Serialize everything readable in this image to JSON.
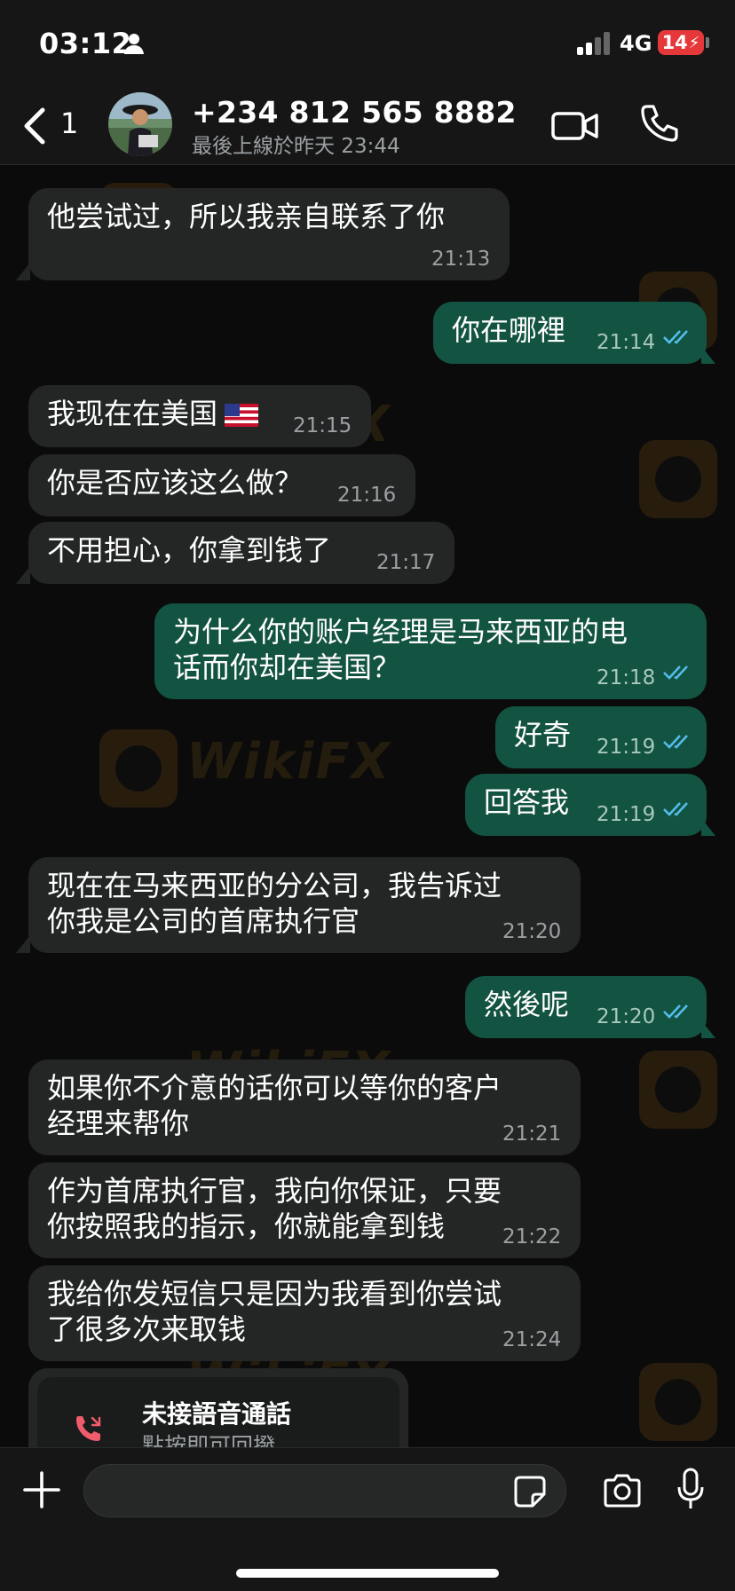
{
  "status_bar": {
    "time": "03:12",
    "network": "4G",
    "battery": "14"
  },
  "header": {
    "back_count": "1",
    "contact_name": "+234 812 565 8882",
    "last_seen": "最後上線於昨天 23:44"
  },
  "watermark": "WikiFX",
  "messages": [
    {
      "direction": "in",
      "text": "他尝试过，所以我亲自联系了你",
      "time": "21:13"
    },
    {
      "direction": "out",
      "text": "你在哪裡",
      "time": "21:14"
    },
    {
      "direction": "in",
      "text": "我现在在美国",
      "emoji": "us-flag",
      "time": "21:15"
    },
    {
      "direction": "in",
      "text": "你是否应该这么做？",
      "time": "21:16"
    },
    {
      "direction": "in",
      "text": "不用担心，你拿到钱了",
      "time": "21:17"
    },
    {
      "direction": "out",
      "lines": [
        "为什么你的账户经理是马来西亚的电",
        "话而你却在美国？"
      ],
      "time": "21:18"
    },
    {
      "direction": "out",
      "text": "好奇",
      "time": "21:19"
    },
    {
      "direction": "out",
      "text": "回答我",
      "time": "21:19"
    },
    {
      "direction": "in",
      "lines": [
        "现在在马来西亚的分公司，我告诉过",
        "你我是公司的首席执行官"
      ],
      "time": "21:20"
    },
    {
      "direction": "out",
      "text": "然後呢",
      "time": "21:20"
    },
    {
      "direction": "in",
      "lines": [
        "如果你不介意的话你可以等你的客户",
        "经理来帮你"
      ],
      "time": "21:21"
    },
    {
      "direction": "in",
      "lines": [
        "作为首席执行官，我向你保证，只要",
        "你按照我的指示，你就能拿到钱"
      ],
      "time": "21:22"
    },
    {
      "direction": "in",
      "lines": [
        "我给你发短信只是因为我看到你尝试",
        "了很多次来取钱"
      ],
      "time": "21:24"
    }
  ],
  "missed_call": {
    "title": "未接語音通話",
    "subtitle": "點按即可回撥"
  },
  "input": {
    "placeholder": ""
  },
  "colors": {
    "incoming": "#242626",
    "outgoing": "#135341",
    "read_ticks": "#53bdeb",
    "missed_icon": "#f15c6d"
  }
}
